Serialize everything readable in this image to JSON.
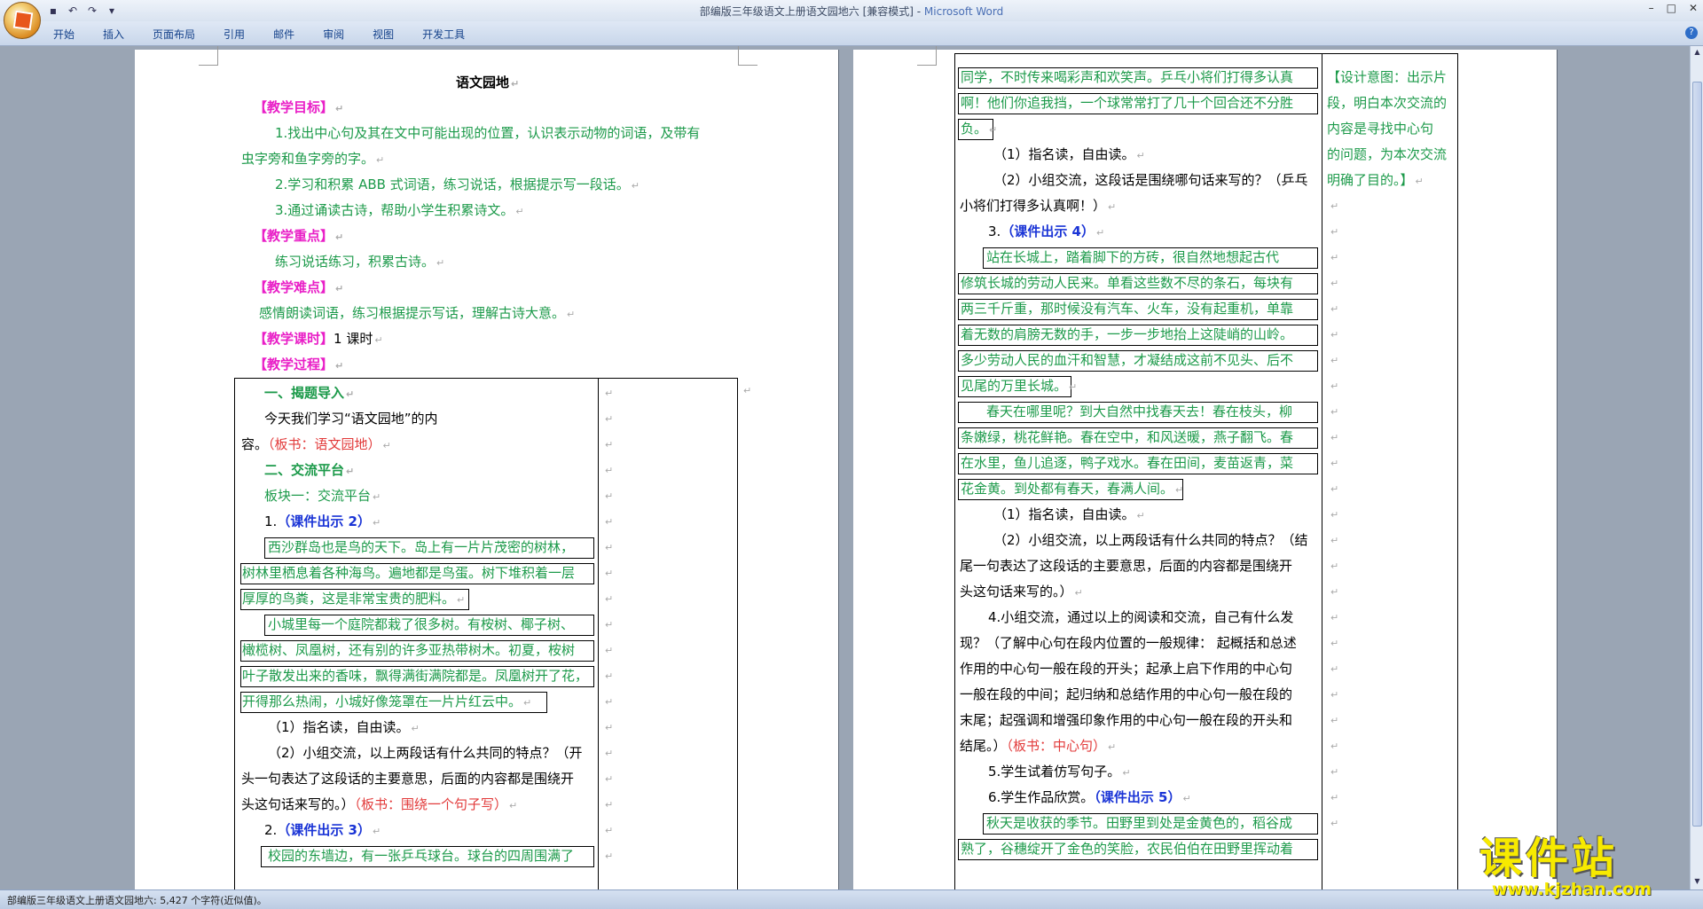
{
  "window": {
    "title": "部编版三年级语文上册语文园地六 [兼容模式] - ",
    "app": "Microsoft Word"
  },
  "tabs": [
    "开始",
    "插入",
    "页面布局",
    "引用",
    "邮件",
    "审阅",
    "视图",
    "开发工具"
  ],
  "status": "部编版三年级语文上册语文园地六: 5,427 个字符(近似值)。",
  "page1": {
    "title": "语文园地",
    "goal_h": "【教学目标】",
    "g1a": "1.找出中心句及其在文中可能出现的位置，认识表示动物的词语，及带有",
    "g1b": "虫字旁和鱼字旁的字。",
    "g2": "2.学习和积累 ABB 式词语，练习说话，根据提示写一段话。",
    "g3": "3.通过诵读古诗，帮助小学生积累诗文。",
    "key_h": "【教学重点】",
    "key": "练习说话练习，积累古诗。",
    "diff_h": "【教学难点】",
    "diff": "感情朗读词语，练习根据提示写话，理解古诗大意。",
    "time_h": "【教学课时】",
    "time": "1 课时",
    "proc_h": "【教学过程】",
    "s1": "一、揭题导入",
    "s1a": "今天我们学习“语文园地”的内",
    "s1b": "容。",
    "s1c": "（板书：语文园地）",
    "s2": "二、交流平台",
    "s2a": "板块一：交流平台",
    "n1": "1.",
    "n1k": "（课件出示 2）",
    "p1": [
      "西沙群岛也是鸟的天下。岛上有一片片茂密的树林，",
      "树林里栖息着各种海鸟。遍地都是鸟蛋。树下堆积着一层",
      "厚厚的鸟粪，这是非常宝贵的肥料。"
    ],
    "p2": [
      "小城里每一个庭院都栽了很多树。有桉树、椰子树、",
      "橄榄树、凤凰树，还有别的许多亚热带树木。初夏，桉树",
      "叶子散发出来的香味，飘得满街满院都是。凤凰树开了花，",
      "开得那么热闹，小城好像笼罩在一片片红云中。"
    ],
    "q1": "（1）指名读，自由读。",
    "q2a": "（2）小组交流，以上两段话有什么共同的特点？（开",
    "q2b": "头一句表达了这段话的主要意思，后面的内容都是围绕开",
    "q2c": "头这句话来写的。）",
    "q2d": "（板书：围绕一个句子写）",
    "n2": "2.",
    "n2k": "（课件出示 3）",
    "p3": "校园的东墙边，有一张乒乓球台。球台的四周围满了"
  },
  "page2": {
    "p3b": [
      "同学，不时传来喝彩声和欢笑声。乒乓小将们打得多认真",
      "啊！他们你追我挡，一个球常常打了几十个回合还不分胜",
      "负。"
    ],
    "r1": "（1）指名读，自由读。",
    "r2a": "（2）小组交流，这段话是围绕哪句话来写的？（乒乓",
    "r2b": "小将们打得多认真啊！）",
    "n3": "3.",
    "n3k": "（课件出示 4）",
    "p4": [
      "站在长城上，踏着脚下的方砖，很自然地想起古代",
      "修筑长城的劳动人民来。单看这些数不尽的条石，每块有",
      "两三千斤重，那时候没有汽车、火车，没有起重机，单靠",
      "着无数的肩膀无数的手，一步一步地抬上这陡峭的山岭。",
      "多少劳动人民的血汗和智慧，才凝结成这前不见头、后不",
      "见尾的万里长城。"
    ],
    "p5": [
      "春天在哪里呢？到大自然中找春天去！春在枝头，柳",
      "条嫩绿，桃花鲜艳。春在空中，和风送暖，燕子翻飞。春",
      "在水里，鱼儿追逐，鸭子戏水。春在田间，麦苗返青，菜",
      "花金黄。到处都有春天，春满人间。"
    ],
    "r3": "（1）指名读，自由读。",
    "r4a": "（2）小组交流，以上两段话有什么共同的特点？（结",
    "r4b": "尾一句表达了这段话的主要意思，后面的内容都是围绕开",
    "r4c": "头这句话来写的。）",
    "r5a": "4.小组交流，通过以上的阅读和交流，自己有什么发",
    "r5b": "现？（了解中心句在段内位置的一般规律： 起概括和总述",
    "r5c": "作用的中心句一般在段的开头；起承上启下作用的中心句",
    "r5d": "一般在段的中间；起归纳和总结作用的中心句一般在段的",
    "r5e": "末尾；起强调和增强印象作用的中心句一般在段的开头和",
    "r5f": "结尾。）",
    "r5g": "（板书：中心句）",
    "r6": "5.学生试着仿写句子。",
    "r7": "6.学生作品欣赏。",
    "r7k": "（课件出示 5）",
    "p6": [
      "秋天是收获的季节。田野里到处是金黄色的，稻谷成",
      "熟了，谷穗绽开了金色的笑脸，农民伯伯在田野里挥动着"
    ],
    "design": [
      "【设计意图：出示片",
      "段，明白本次交流的",
      "内容是寻找中心句",
      "的问题，为本次交流",
      "明确了目的。】"
    ]
  },
  "logo": {
    "text": "课件站",
    "url": "www.kjzhan.com"
  }
}
